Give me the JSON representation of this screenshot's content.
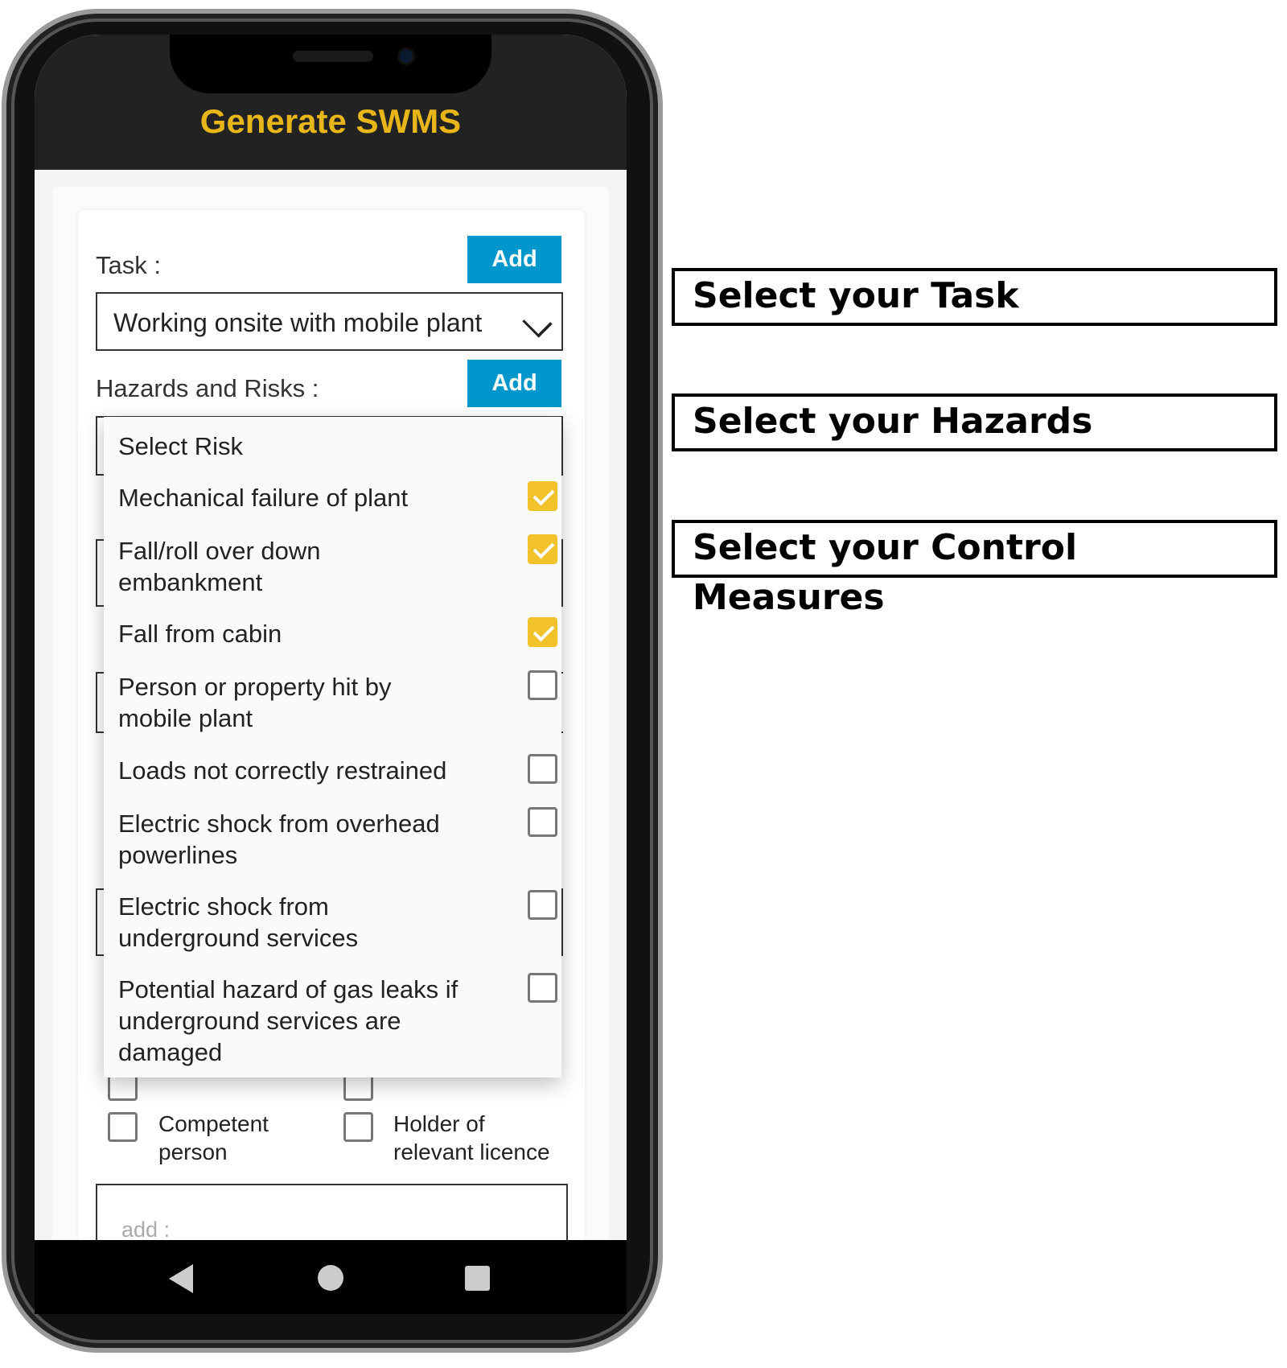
{
  "header": {
    "title": "Generate SWMS"
  },
  "form": {
    "task_label": "Task :",
    "task_add": "Add",
    "task_value": "Working onsite with mobile plant",
    "hazards_label": "Hazards and Risks :",
    "hazards_add": "Add",
    "competent": "Competent person",
    "holder": "Holder of relevant licence",
    "add_placeholder": "add :"
  },
  "dropdown": {
    "title": "Select Risk",
    "items": [
      {
        "label": "Mechanical failure of plant",
        "checked": true
      },
      {
        "label": "Fall/roll over down embankment",
        "checked": true
      },
      {
        "label": "Fall from cabin",
        "checked": true
      },
      {
        "label": "Person or property hit by mobile plant",
        "checked": false
      },
      {
        "label": "Loads not correctly restrained",
        "checked": false
      },
      {
        "label": "Electric shock from overhead powerlines",
        "checked": false
      },
      {
        "label": "Electric shock from underground services",
        "checked": false
      },
      {
        "label": "Potential hazard of gas leaks if underground services are damaged",
        "checked": false
      }
    ],
    "check_color": "#f2c22a"
  },
  "annotations": [
    "Select your Task",
    "Select your Hazards",
    "Select your Control Measures"
  ],
  "colors": {
    "accent": "#e8b619",
    "button": "#0098cc"
  }
}
